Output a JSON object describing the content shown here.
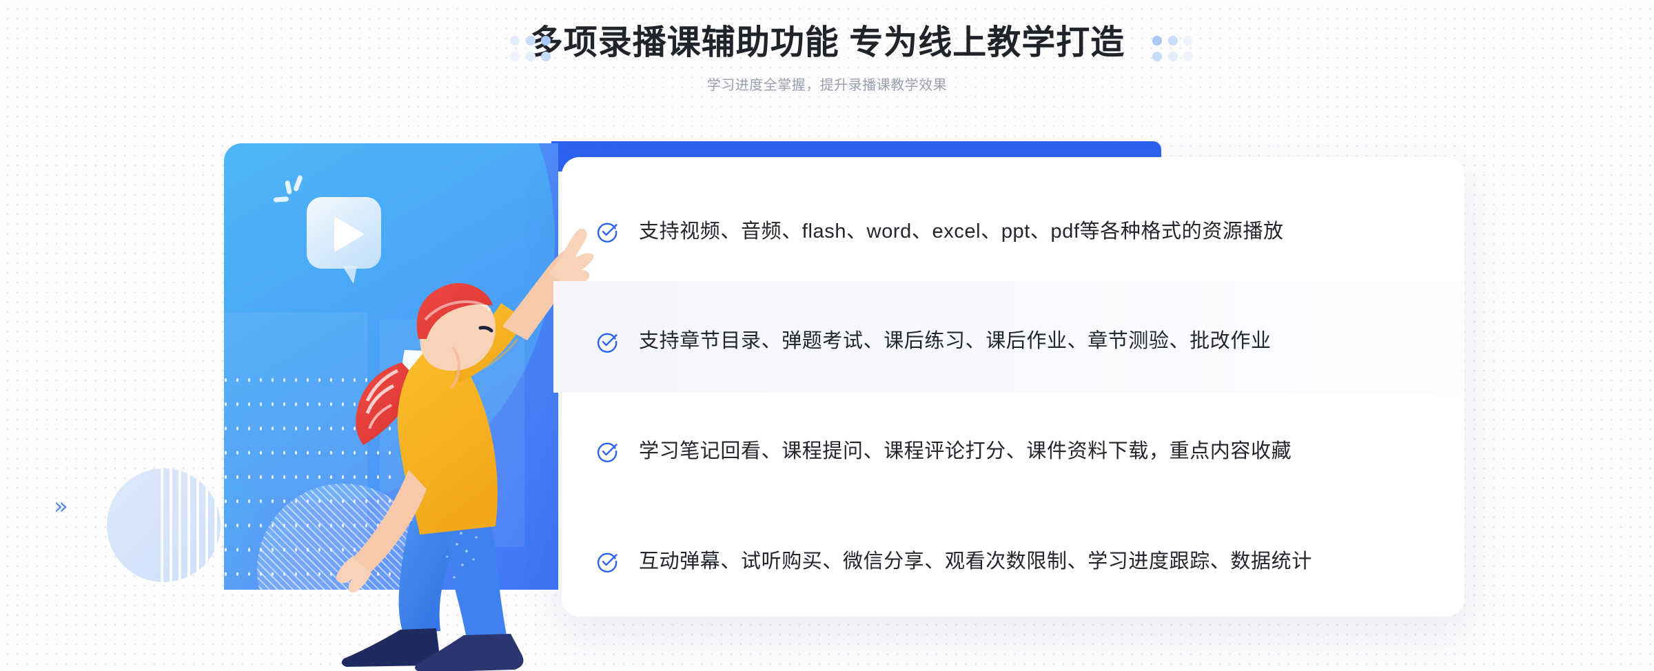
{
  "header": {
    "title": "多项录播课辅助功能 专为线上教学打造",
    "subtitle": "学习进度全掌握，提升录播课教学效果"
  },
  "features": [
    {
      "icon": "check-circle-icon",
      "text": "支持视频、音频、flash、word、excel、ppt、pdf等各种格式的资源播放",
      "highlighted": false
    },
    {
      "icon": "check-circle-icon",
      "text": "支持章节目录、弹题考试、课后练习、课后作业、章节测验、批改作业",
      "highlighted": true
    },
    {
      "icon": "check-circle-icon",
      "text": "学习笔记回看、课程提问、课程评论打分、课件资料下载，重点内容收藏",
      "highlighted": false
    },
    {
      "icon": "check-circle-icon",
      "text": "互动弹幕、试听购买、微信分享、观看次数限制、学习进度跟踪、数据统计",
      "highlighted": false
    }
  ],
  "illustration": {
    "name": "online-course-illustration",
    "play_bubble_icon": "play-button-speech-bubble-icon",
    "person_alt": "woman-pointing-up-illustration",
    "chevron_glyph": "»"
  },
  "decorations": {
    "chevron_glyph": "»",
    "dot_cluster_left": "decorative-dot-grid-left",
    "dot_cluster_right": "decorative-dot-grid-right"
  },
  "colors": {
    "accent_blue": "#2b63ef",
    "check_blue": "#2b63ef",
    "title_text": "#20232a",
    "subtitle_text": "#9aa0ad",
    "body_text": "#22252b",
    "card_gradient_start": "#4fc3f7",
    "card_gradient_end": "#3d73f5",
    "page_background": "#fcfcfd",
    "row_highlight": "#f5f7fb"
  }
}
